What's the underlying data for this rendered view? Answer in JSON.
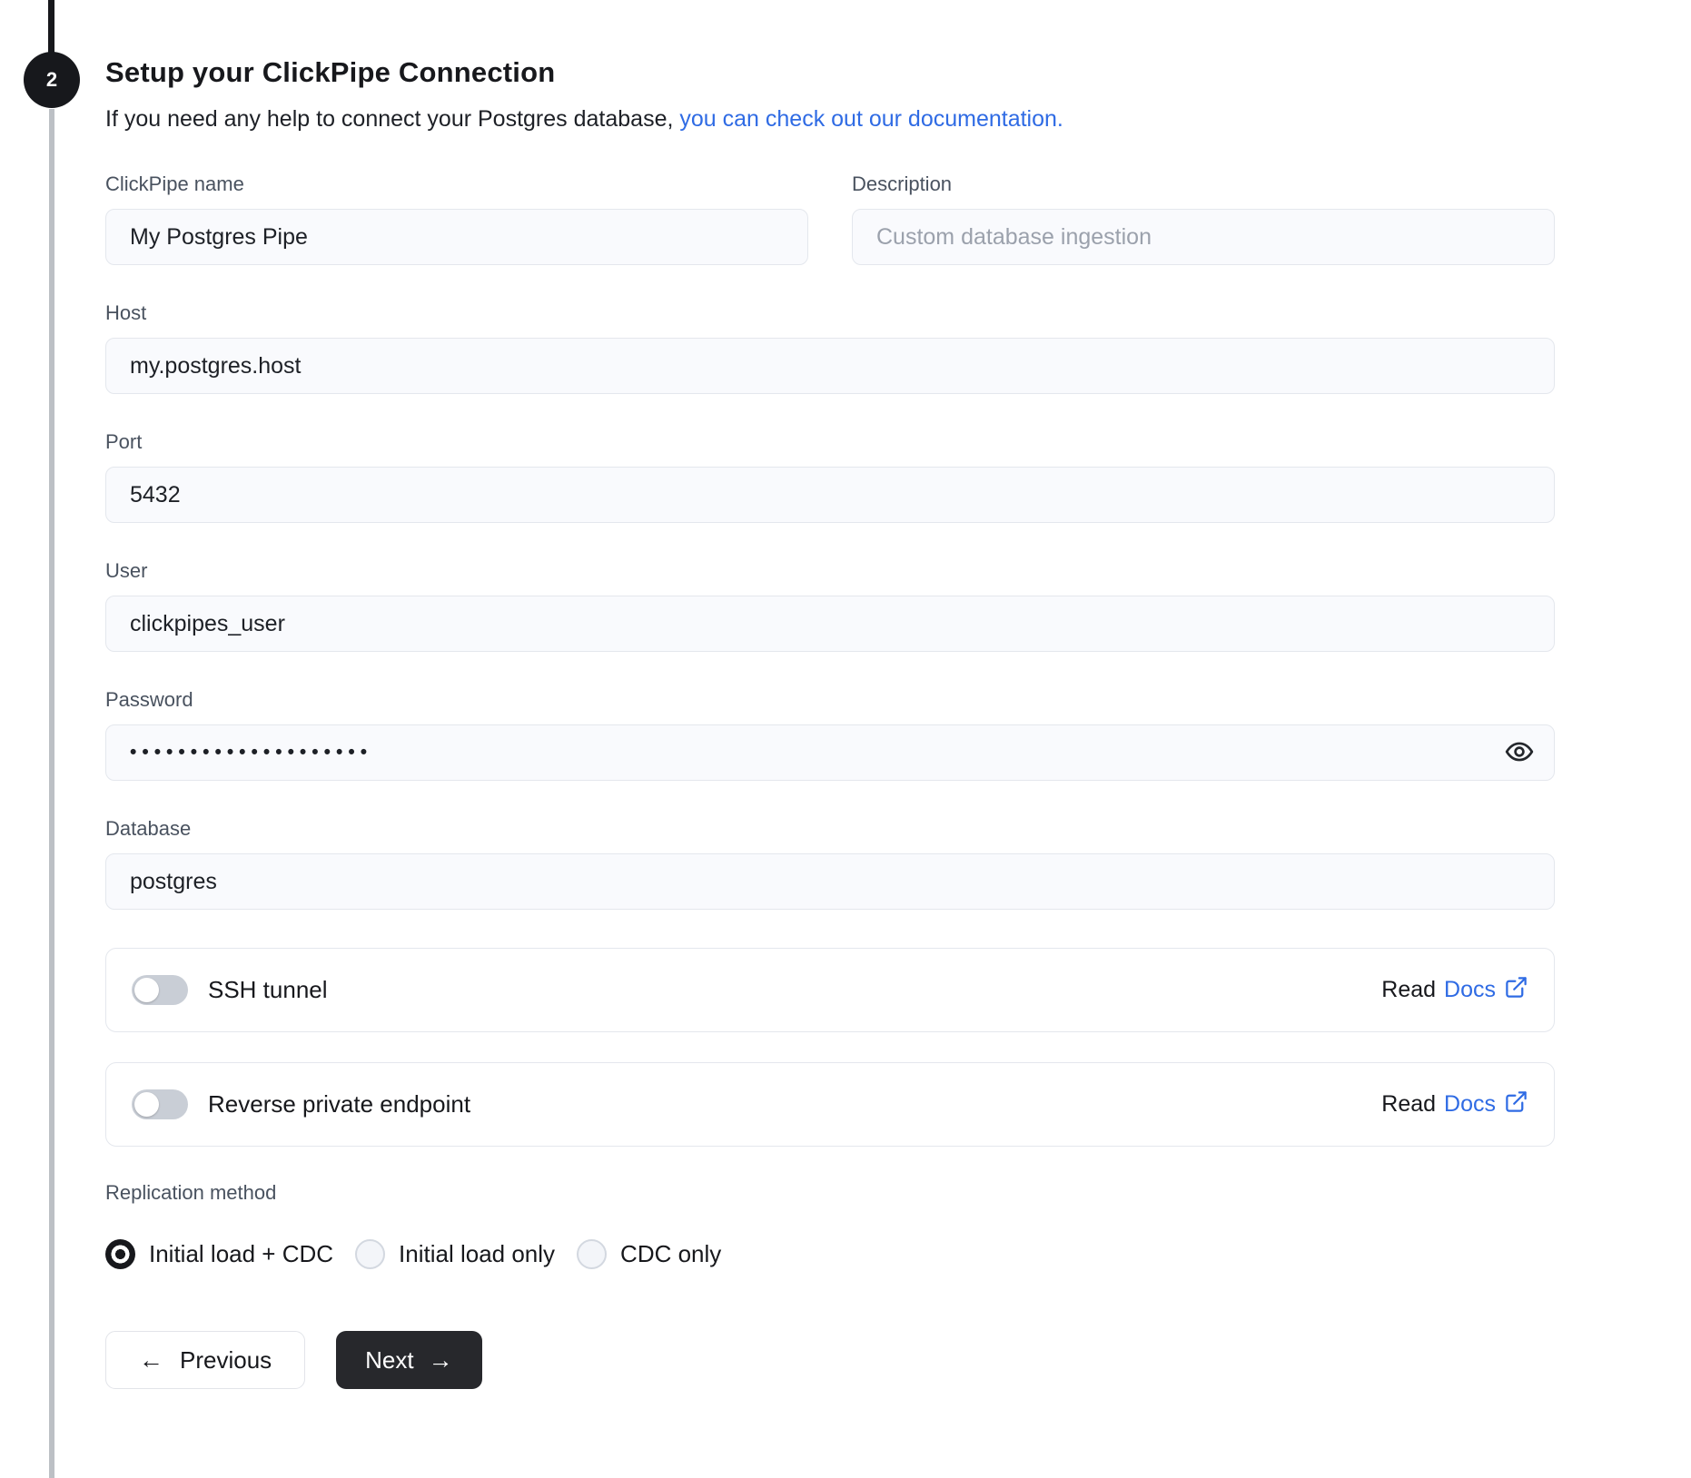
{
  "step": {
    "number": "2",
    "title": "Setup your ClickPipe Connection",
    "subtitle_text": "If you need any help to connect your Postgres database, ",
    "subtitle_link": "you can check out our documentation."
  },
  "form": {
    "clickpipe_name": {
      "label": "ClickPipe name",
      "value": "My Postgres Pipe"
    },
    "description": {
      "label": "Description",
      "placeholder": "Custom database ingestion"
    },
    "host": {
      "label": "Host",
      "value": "my.postgres.host"
    },
    "port": {
      "label": "Port",
      "value": "5432"
    },
    "user": {
      "label": "User",
      "value": "clickpipes_user"
    },
    "password": {
      "label": "Password",
      "value": "••••••••••••••••••••"
    },
    "database": {
      "label": "Database",
      "value": "postgres"
    }
  },
  "toggles": [
    {
      "label": "SSH tunnel",
      "enabled": false,
      "read_text": "Read",
      "docs_text": "Docs"
    },
    {
      "label": "Reverse private endpoint",
      "enabled": false,
      "read_text": "Read",
      "docs_text": "Docs"
    }
  ],
  "replication": {
    "label": "Replication method",
    "selected": "Initial load + CDC",
    "options": [
      {
        "label": "Initial load + CDC",
        "selected": true
      },
      {
        "label": "Initial load only",
        "selected": false
      },
      {
        "label": "CDC only",
        "selected": false
      }
    ]
  },
  "buttons": {
    "previous": "Previous",
    "next": "Next"
  },
  "icons": {
    "left_arrow": "←",
    "right_arrow": "→",
    "password_toggle": "eye-icon",
    "docs_external": "external-link-icon"
  },
  "colors": {
    "link": "#2f6be4",
    "next_button_bg": "#27282c",
    "step_circle": "#17181c",
    "field_bg": "#f9fafd",
    "field_border": "#e4e7ed",
    "toggle_off": "#c9ced6"
  }
}
